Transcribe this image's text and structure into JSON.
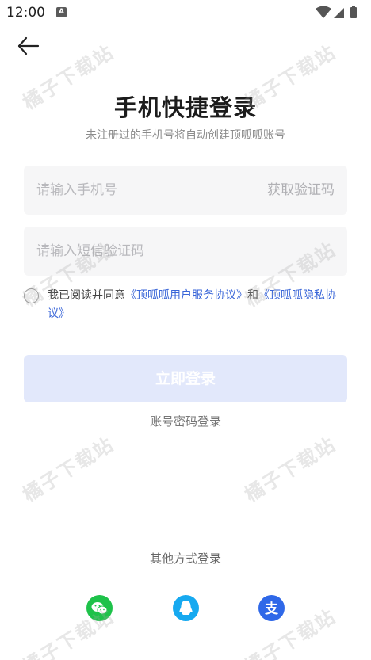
{
  "status_bar": {
    "time": "12:00",
    "notification_badge": "A",
    "icons": [
      "wifi-icon",
      "signal-icon",
      "battery-icon"
    ]
  },
  "header": {
    "back_icon": "arrow-left-icon"
  },
  "title": "手机快捷登录",
  "subtitle": "未注册过的手机号将自动创建顶呱呱账号",
  "phone_field": {
    "placeholder": "请输入手机号",
    "value": "",
    "get_code_label": "获取验证码"
  },
  "code_field": {
    "placeholder": "请输入短信验证码",
    "value": ""
  },
  "agreement": {
    "checked": false,
    "prefix": "我已阅读并同意",
    "user_agreement": "《顶呱呱用户服务协议》",
    "and": "和",
    "privacy_policy": "《顶呱呱隐私协议》"
  },
  "login_button": "立即登录",
  "password_login": "账号密码登录",
  "other_methods": {
    "label": "其他方式登录",
    "options": [
      "wechat-icon",
      "qq-icon",
      "alipay-icon"
    ]
  },
  "watermark_text": "橘子下载站",
  "colors": {
    "link": "#3a66d8",
    "button_disabled": "#e2e8fb",
    "wechat": "#1ec24a",
    "qq": "#16a9f0",
    "alipay": "#2f68e8"
  }
}
